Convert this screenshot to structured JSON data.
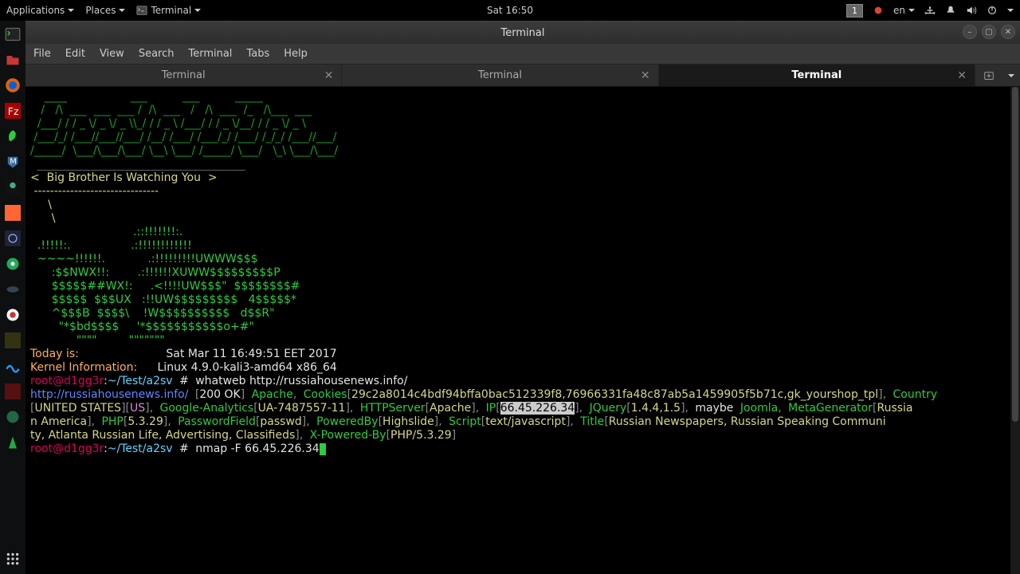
{
  "panel": {
    "applications": "Applications",
    "places": "Places",
    "app_label": "Terminal",
    "clock": "Sat 16:50",
    "workspace": "1",
    "lang": "en"
  },
  "window": {
    "title": "Terminal"
  },
  "menu": {
    "file": "File",
    "edit": "Edit",
    "view": "View",
    "search": "Search",
    "terminal": "Terminal",
    "tabs": "Tabs",
    "help": "Help"
  },
  "tabs": {
    "t1": "Terminal",
    "t2": "Terminal",
    "t3": "Terminal"
  },
  "motd": {
    "banner": "<  Big Brother Is Watching You  >",
    "dashes": " -------------------------------"
  },
  "info": {
    "today_lbl": "Today is:",
    "today_val": "Sat Mar 11 16:49:51 EET 2017",
    "kernel_lbl": "Kernel Information:",
    "kernel_val": "Linux 4.9.0-kali3-amd64 x86_64"
  },
  "prompt": {
    "user": "root@d1gg3r",
    "path": "~/Test/a2sv",
    "sep": ":",
    "hash": "#"
  },
  "cmd1": "whatweb http://russiahousenews.info/",
  "whatweb": {
    "url": "http://russiahousenews.info/",
    "status": "200 OK",
    "apache": "Apache",
    "cookies_lbl": "Cookies",
    "cookies_val": "29c2a8014c4bdf94bffa0bac512339f8,76966331fa48c87ab5a1459905f5b71c,gk_yourshop_tpl",
    "country_lbl": "Country",
    "country_val": "UNITED STATES",
    "country_code": "US",
    "ga_lbl": "Google-Analytics",
    "ga_val": "UA-7487557-11",
    "httpsrv_lbl": "HTTPServer",
    "httpsrv_val": "Apache",
    "ip_lbl": "IP",
    "ip_val": "66.45.226.34",
    "jquery_lbl": "JQuery",
    "jquery_val": "1.4.4,1.5",
    "maybe": "maybe",
    "joomla": "Joomla",
    "metagen_lbl": "MetaGenerator",
    "metagen_val": "Russian America",
    "php_lbl": "PHP",
    "php_val": "5.3.29",
    "pwd_lbl": "PasswordField",
    "pwd_val": "passwd",
    "pwr_lbl": "PoweredBy",
    "pwr_val": "Highslide",
    "script_lbl": "Script",
    "script_val": "text/javascript",
    "title_lbl": "Title",
    "title_val": "Russian Newspapers, Russian Speaking Community, Atlanta Russian Life, Advertising, Classifieds",
    "xpwr_lbl": "X-Powered-By",
    "xpwr_val": "PHP/5.3.29"
  },
  "cmd2": "nmap -F 66.45.226.34"
}
